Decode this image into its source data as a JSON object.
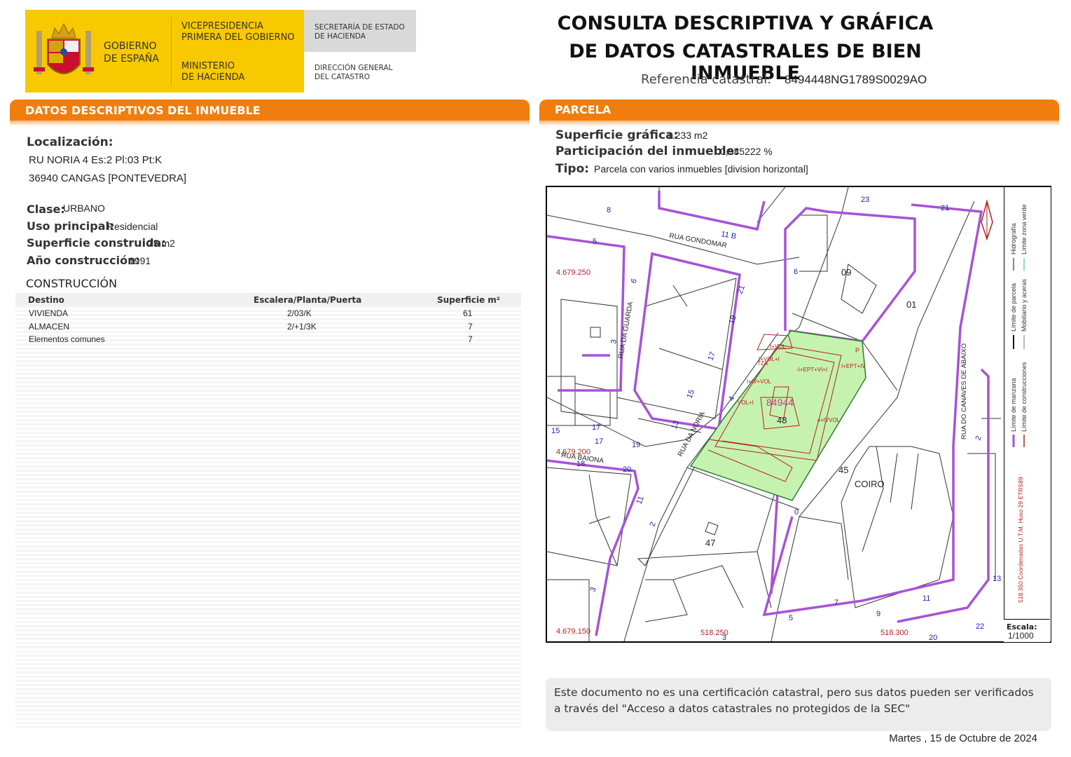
{
  "header": {
    "gov_name_line1": "GOBIERNO",
    "gov_name_line2": "DE ESPAÑA",
    "vice_line1": "VICEPRESIDENCIA",
    "vice_line2": "PRIMERA DEL GOBIERNO",
    "ministry_line1": "MINISTERIO",
    "ministry_line2": "DE HACIENDA",
    "secretaria_line1": "SECRETARÍA DE ESTADO",
    "secretaria_line2": "DE HACIENDA",
    "direccion_line1": "DIRECCIÓN GENERAL",
    "direccion_line2": "DEL CATASTRO",
    "title_line1": "CONSULTA DESCRIPTIVA Y GRÁFICA",
    "title_line2": "DE DATOS CATASTRALES DE BIEN INMUEBLE",
    "ref_label": "Referencia catastral:",
    "ref_value": "8494448NG1789S0029AO"
  },
  "descriptivos": {
    "section_title": "DATOS DESCRIPTIVOS DEL INMUEBLE",
    "localizacion_label": "Localización:",
    "address_line1": "RU NORIA 4 Es:2 Pl:03 Pt:K",
    "address_line2": "36940 CANGAS [PONTEVEDRA]",
    "clase_label": "Clase:",
    "clase_value": "URBANO",
    "uso_label": "Uso principal:",
    "uso_value": "Residencial",
    "superficie_label": "Superficie construida:",
    "superficie_value": "75 m2",
    "anio_label": "Año construcción:",
    "anio_value": "1991"
  },
  "construccion": {
    "title": "CONSTRUCCIÓN",
    "headers": [
      "Destino",
      "Escalera/Planta/Puerta",
      "Superficie m²"
    ],
    "rows": [
      {
        "destino": "VIVIENDA",
        "epp": "2/03/K",
        "sup": "61"
      },
      {
        "destino": "ALMACEN",
        "epp": "2/+1/3K",
        "sup": "7"
      },
      {
        "destino": "Elementos comunes",
        "epp": "",
        "sup": "7"
      }
    ]
  },
  "parcela": {
    "section_title": "PARCELA",
    "sup_label": "Superficie gráfica:",
    "sup_value": "1.233 m2",
    "part_label": "Participación del inmueble:",
    "part_value": "0,985222 %",
    "tipo_label": "Tipo:",
    "tipo_value": "Parcela con varios inmuebles [division horizontal]"
  },
  "map": {
    "colors": {
      "parcel_fill": "#c6f2b0",
      "manzana": "#a653d6",
      "construcciones": "#b22222",
      "lines": "#333333"
    },
    "parcel_ref": "84944",
    "labels": {
      "n48": "48",
      "n45": "45",
      "n47": "47",
      "n09": "09",
      "n01": "01",
      "coiro": "COIRO",
      "rua_gondomar": "RUA GONDOMAR",
      "rua_guarda": "RUA DA GUARDA",
      "rua_noria": "RUA DA NORIA",
      "rua_baiona": "RUA BAIONA",
      "rua_canaves": "RUA DO CANAVES DE ABAIXO",
      "coord_y1": "4.679.250",
      "coord_y2": "4.679.200",
      "coord_y3": "4.679.150",
      "coord_x1": "518.250",
      "coord_x2": "518.300",
      "num_8": "8",
      "num_23": "23",
      "num_21a": "21",
      "num_11b": "11 B",
      "num_5": "5",
      "num_6": "6",
      "num_21b": "21",
      "num_19": "19",
      "num_17": "17",
      "num_15": "15",
      "num_13": "13",
      "num_4": "4",
      "num_3": "3",
      "num_15b": "15",
      "num_17b": "17",
      "num_17c": "17",
      "num_19b": "19",
      "num_18": "18",
      "num_20": "20",
      "num_11": "11",
      "num_2": "2",
      "num_0": "0",
      "num_3b": "3",
      "num_5b": "5",
      "num_7": "7",
      "num_9": "9",
      "num_11c": "11",
      "num_13b": "13",
      "num_22": "22",
      "num_20b": "20",
      "num_3c": "3",
      "num_2b": "2",
      "num_6b": "6",
      "num_p": "P",
      "vol_1": "I+VOL",
      "vol_2": "-I+EPT+VI+I",
      "vol_3": "I+VOL+I",
      "vol_4": "TZA",
      "vol_5": "-I+IVVOL",
      "vol_6": "I+EPT+IV",
      "vol_7": "I+IV+VOL",
      "vol_8": "VOL+I"
    },
    "legend": {
      "hidrografia": "Hidrografía",
      "zona_verde": "Límite zona verde",
      "parcela": "Límite de parcela",
      "mobiliario": "Mobiliario y aceras",
      "manzana": "Límite de manzana",
      "construcciones": "Límite de construcciones",
      "coords": "518.350 Coordenadas U.T.M. Huso 29 ETRS89"
    },
    "escala_label": "Escala:",
    "escala_value": "1/1000"
  },
  "notice": "Este documento no es una certificación catastral, pero sus datos pueden ser verificados a través del \"Acceso a datos catastrales no protegidos de la SEC\"",
  "date": "Martes , 15 de Octubre de 2024"
}
